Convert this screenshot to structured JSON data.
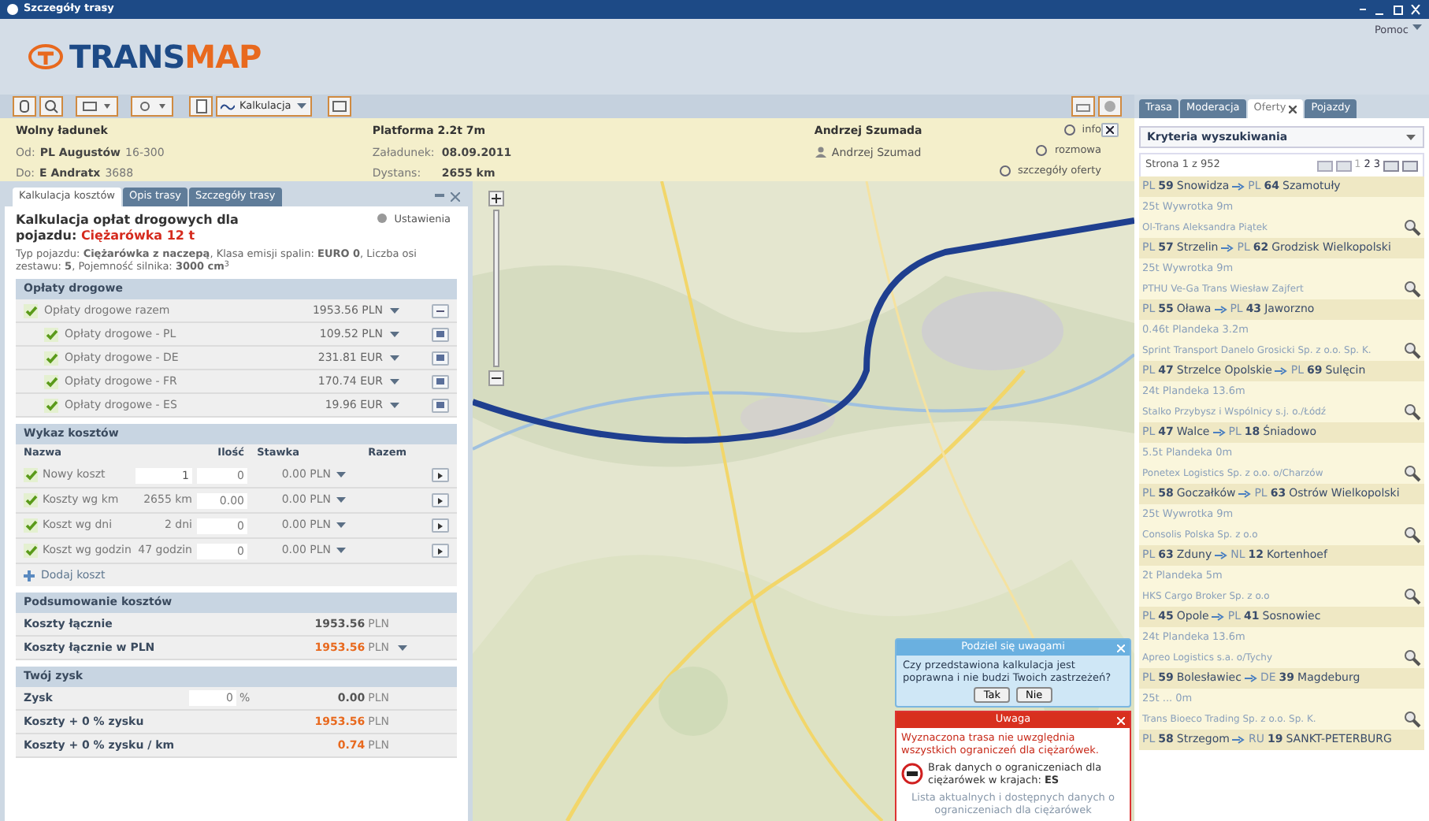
{
  "window": {
    "title": "Szczegóły trasy"
  },
  "logo": {
    "part_1": "TRANS",
    "part_2": "MAP"
  },
  "help_menu": "Pomoc",
  "toolbar": {
    "calc_button": "Kalkulacja"
  },
  "offer_summary": {
    "title": "Wolny ładunek",
    "from_label": "Od:",
    "from_value": "PL Augustów",
    "from_code": "16-300",
    "to_label": "Do:",
    "to_value": "E Andratx",
    "to_code": "3688",
    "vehicle": "Platforma 2.2t 7m",
    "load_label": "Załadunek:",
    "load_value": "08.09.2011",
    "distance_label": "Dystans:",
    "distance_value": "2655 km",
    "contact_name": "Andrzej Szumada",
    "contact_user": "Andrzej Szumad",
    "links": [
      "info",
      "rozmowa",
      "szczegóły oferty"
    ]
  },
  "left_panel": {
    "tabs": [
      {
        "label": "Kalkulacja kosztów",
        "selected": true
      },
      {
        "label": "Opis trasy",
        "selected": false
      },
      {
        "label": "Szczegóły trasy",
        "selected": false
      }
    ],
    "settings": "Ustawienia",
    "heading": "Kalkulacja opłat drogowych dla pojazdu:",
    "vehicle": "Ciężarówka 12 t",
    "description": "Typ pojazdu: **Ciężarówka z naczepą**, Klasa emisji spalin: **EURO 0**, Liczba osi zestawu: **5**, Pojemność silnika: **3000 cm**$^{3}$",
    "tolls": {
      "title": "Opłaty drogowe",
      "total": {
        "label": "Opłaty drogowe razem",
        "amount": "1953.56 PLN",
        "checked": true,
        "expanded": true
      },
      "items": [
        {
          "label": "Opłaty drogowe - PL",
          "amount": "109.52 PLN",
          "checked": true
        },
        {
          "label": "Opłaty drogowe - DE",
          "amount": "231.81 EUR",
          "checked": true
        },
        {
          "label": "Opłaty drogowe - FR",
          "amount": "170.74 EUR",
          "checked": true
        },
        {
          "label": "Opłaty drogowe - ES",
          "amount": "19.96 EUR",
          "checked": true
        }
      ]
    },
    "costs": {
      "title": "Wykaz kosztów",
      "columns": [
        "Nazwa",
        "Ilość",
        "Stawka",
        "Razem"
      ],
      "rows": [
        {
          "name": "Nowy koszt",
          "checked": true,
          "kind": "input",
          "quantity": "1",
          "rate": "0",
          "total": "0.00 PLN"
        },
        {
          "name": "Koszty wg km",
          "checked": true,
          "kind": "text",
          "quantity": "2655 km",
          "rate": "0.00",
          "total": "0.00 PLN"
        },
        {
          "name": "Koszt wg dni",
          "checked": true,
          "kind": "text",
          "quantity": "2 dni",
          "rate": "0",
          "total": "0.00 PLN"
        },
        {
          "name": "Koszt wg godzin",
          "checked": true,
          "kind": "text",
          "quantity": "47 godzin",
          "rate": "0",
          "total": "0.00 PLN"
        }
      ],
      "add_button": "Dodaj koszt"
    },
    "summary": {
      "title": "Podsumowanie kosztów",
      "rows": [
        {
          "label": "Koszty łącznie",
          "amount": "1953.56",
          "currency": "PLN",
          "highlight": false,
          "dropdown": false
        },
        {
          "label": "Koszty łącznie w PLN",
          "amount": "1953.56",
          "currency": "PLN",
          "highlight": true,
          "dropdown": true
        }
      ]
    },
    "profit": {
      "title": "Twój zysk",
      "label": "Zysk",
      "value": "0",
      "unit": "%",
      "amount": "0.00",
      "currency": "PLN",
      "rows": [
        {
          "label": "Koszty + 0 % zysku",
          "amount": "1953.56",
          "currency": "PLN",
          "highlight": true
        },
        {
          "label": "Koszty + 0 % zysku / km",
          "amount": "0.74",
          "currency": "PLN",
          "highlight": true
        }
      ]
    }
  },
  "dialogs": {
    "feedback": {
      "title": "Podziel się uwagami",
      "question": "Czy przedstawiona kalkulacja jest poprawna i nie budzi Twoich zastrzeżeń?",
      "buttons": [
        "Tak",
        "Nie"
      ]
    },
    "warning": {
      "title": "Uwaga",
      "message": "Wyznaczona trasa nie uwzględnia wszystkich ograniczeń dla ciężarówek.",
      "detail": "Brak danych o ograniczeniach dla ciężarówek w krajach: **ES**",
      "note": "Lista aktualnych i dostępnych danych o ograniczeniach dla ciężarówek"
    }
  },
  "right_panel": {
    "tabs": [
      {
        "label": "Trasa",
        "selected": false,
        "closable": false
      },
      {
        "label": "Moderacja",
        "selected": false,
        "closable": false
      },
      {
        "label": "Oferty",
        "selected": true,
        "closable": true
      },
      {
        "label": "Pojazdy",
        "selected": false,
        "closable": false
      }
    ],
    "criteria": "Kryteria wyszukiwania",
    "page_info": "Strona 1 z 952",
    "pages": [
      {
        "label": "1",
        "selected": true
      },
      {
        "label": "2",
        "selected": false
      },
      {
        "label": "3",
        "selected": false
      }
    ],
    "offers": [
      {
        "from_country": "PL",
        "from_code": "59",
        "from_city": "Snowidza",
        "to_country": "PL",
        "to_code": "64",
        "to_city": "Szamotuły",
        "cargo": "25t Wywrotka 9m",
        "company": "Ol-Trans Aleksandra Piątek"
      },
      {
        "from_country": "PL",
        "from_code": "57",
        "from_city": "Strzelin",
        "to_country": "PL",
        "to_code": "62",
        "to_city": "Grodzisk Wielkopolski",
        "cargo": "25t Wywrotka 9m",
        "company": "PTHU Ve-Ga Trans Wiesław Zajfert"
      },
      {
        "from_country": "PL",
        "from_code": "55",
        "from_city": "Oława",
        "to_country": "PL",
        "to_code": "43",
        "to_city": "Jaworzno",
        "cargo": "0.46t Plandeka 3.2m",
        "company": "Sprint Transport Danelo Grosicki Sp. z o.o. Sp. K."
      },
      {
        "from_country": "PL",
        "from_code": "47",
        "from_city": "Strzelce Opolskie",
        "to_country": "PL",
        "to_code": "69",
        "to_city": "Sulęcin",
        "cargo": "24t Plandeka 13.6m",
        "company": "Stalko Przybysz i Wspólnicy s.j. o./Łódź"
      },
      {
        "from_country": "PL",
        "from_code": "47",
        "from_city": "Walce",
        "to_country": "PL",
        "to_code": "18",
        "to_city": "Śniadowo",
        "cargo": "5.5t Plandeka 0m",
        "company": "Ponetex Logistics Sp. z o.o. o/Charzów"
      },
      {
        "from_country": "PL",
        "from_code": "58",
        "from_city": "Goczałków",
        "to_country": "PL",
        "to_code": "63",
        "to_city": "Ostrów Wielkopolski",
        "cargo": "25t Wywrotka 9m",
        "company": "Consolis Polska Sp. z o.o"
      },
      {
        "from_country": "PL",
        "from_code": "63",
        "from_city": "Zduny",
        "to_country": "NL",
        "to_code": "12",
        "to_city": "Kortenhoef",
        "cargo": "2t Plandeka 5m",
        "company": "HKS Cargo Broker Sp. z o.o"
      },
      {
        "from_country": "PL",
        "from_code": "45",
        "from_city": "Opole",
        "to_country": "PL",
        "to_code": "41",
        "to_city": "Sosnowiec",
        "cargo": "24t Plandeka 13.6m",
        "company": "Apreo Logistics s.a. o/Tychy"
      },
      {
        "from_country": "PL",
        "from_code": "59",
        "from_city": "Bolesławiec",
        "to_country": "DE",
        "to_code": "39",
        "to_city": "Magdeburg",
        "cargo": "25t ... 0m",
        "company": "Trans Bioeco Trading Sp. z o.o. Sp. K."
      },
      {
        "from_country": "PL",
        "from_code": "58",
        "from_city": "Strzegom",
        "to_country": "RU",
        "to_code": "19",
        "to_city": "SANKT-PETERBURG"
      }
    ]
  }
}
